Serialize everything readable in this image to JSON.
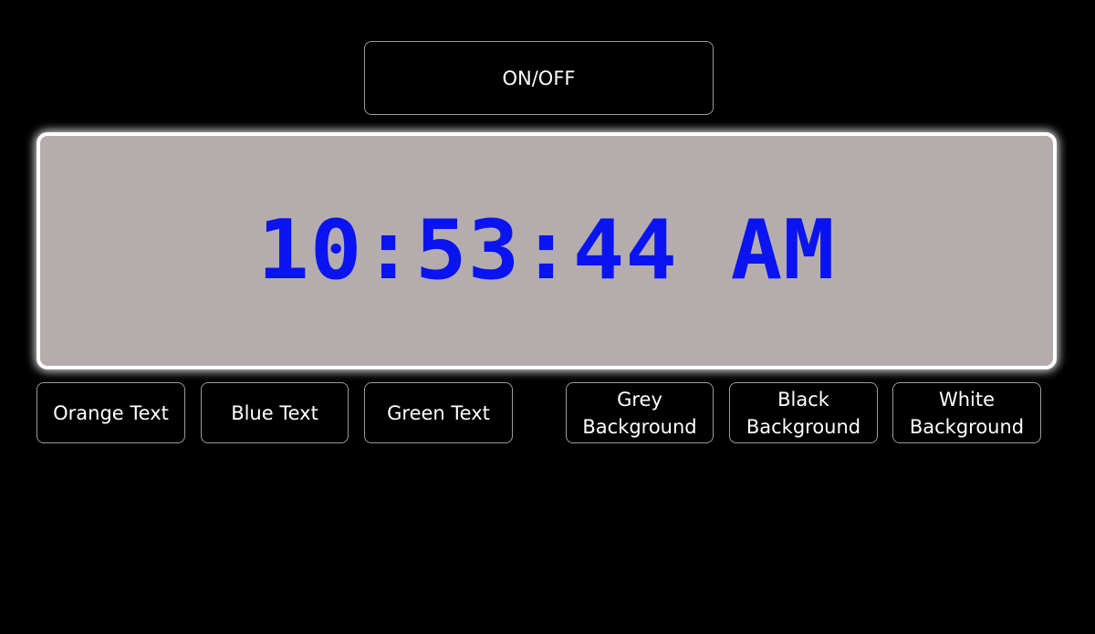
{
  "toggle_button": {
    "label": "ON/OFF"
  },
  "clock": {
    "time": "10:53:44 AM",
    "text_color": "#0a14f0",
    "background_color": "#b5adad",
    "border_color": "#ffffff"
  },
  "text_color_options": [
    {
      "label": "Orange Text"
    },
    {
      "label": "Blue Text"
    },
    {
      "label": "Green Text"
    }
  ],
  "background_options": [
    {
      "label": "Grey\nBackground"
    },
    {
      "label": "Black\nBackground"
    },
    {
      "label": "White\nBackground"
    }
  ],
  "colors": {
    "page_background": "#000000",
    "button_border": "#9a9a9a",
    "button_text": "#ffffff"
  }
}
